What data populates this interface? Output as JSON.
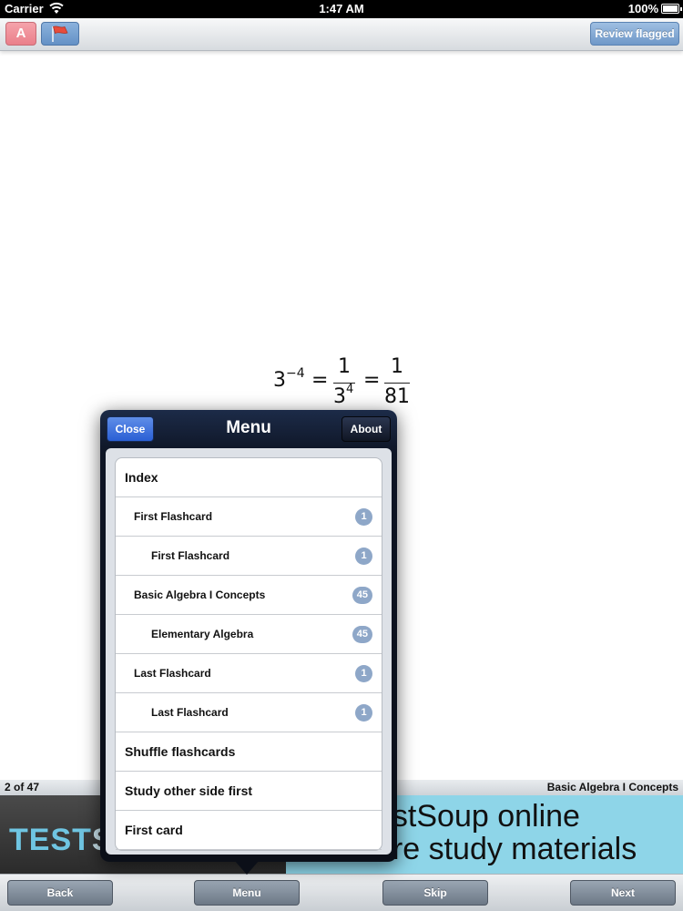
{
  "status_bar": {
    "carrier": "Carrier",
    "time": "1:47 AM",
    "battery": "100%"
  },
  "top_toolbar": {
    "font_button": "A",
    "flag_icon": "flag-icon",
    "review_flagged": "Review flagged"
  },
  "card": {
    "formula": {
      "base": "3",
      "exponent": "−4",
      "eq1": "=",
      "num1": "1",
      "den1_base": "3",
      "den1_exp": "4",
      "eq2": "=",
      "num2": "1",
      "den2": "81"
    }
  },
  "info_bar": {
    "card_count": "2 of 47",
    "deck_title": "Basic Algebra I Concepts"
  },
  "ad_banner": {
    "logo_prefix": "TEST",
    "logo_suffix": "SC",
    "line1": "estSoup online",
    "line2": "ore study materials"
  },
  "popover": {
    "close_label": "Close",
    "title": "Menu",
    "about_label": "About",
    "items": [
      {
        "label": "Index",
        "level": 0,
        "badge": ""
      },
      {
        "label": "First Flashcard",
        "level": 1,
        "badge": "1"
      },
      {
        "label": "First Flashcard",
        "level": 2,
        "badge": "1"
      },
      {
        "label": "Basic Algebra I Concepts",
        "level": 1,
        "badge": "45"
      },
      {
        "label": "Elementary Algebra",
        "level": 2,
        "badge": "45"
      },
      {
        "label": "Last Flashcard",
        "level": 1,
        "badge": "1"
      },
      {
        "label": "Last Flashcard",
        "level": 2,
        "badge": "1"
      },
      {
        "label": "Shuffle flashcards",
        "level": 0,
        "badge": ""
      },
      {
        "label": "Study other side first",
        "level": 0,
        "badge": ""
      },
      {
        "label": "First card",
        "level": 0,
        "badge": ""
      }
    ]
  },
  "bottom_toolbar": {
    "back": "Back",
    "menu": "Menu",
    "skip": "Skip",
    "next": "Next"
  },
  "colors": {
    "accent_blue": "#6f98c8",
    "font_button_pink": "#ea7f8a",
    "popover_dark": "#0e1525",
    "badge": "#8ea7c8",
    "banner_cyan": "#8ed5e8"
  }
}
